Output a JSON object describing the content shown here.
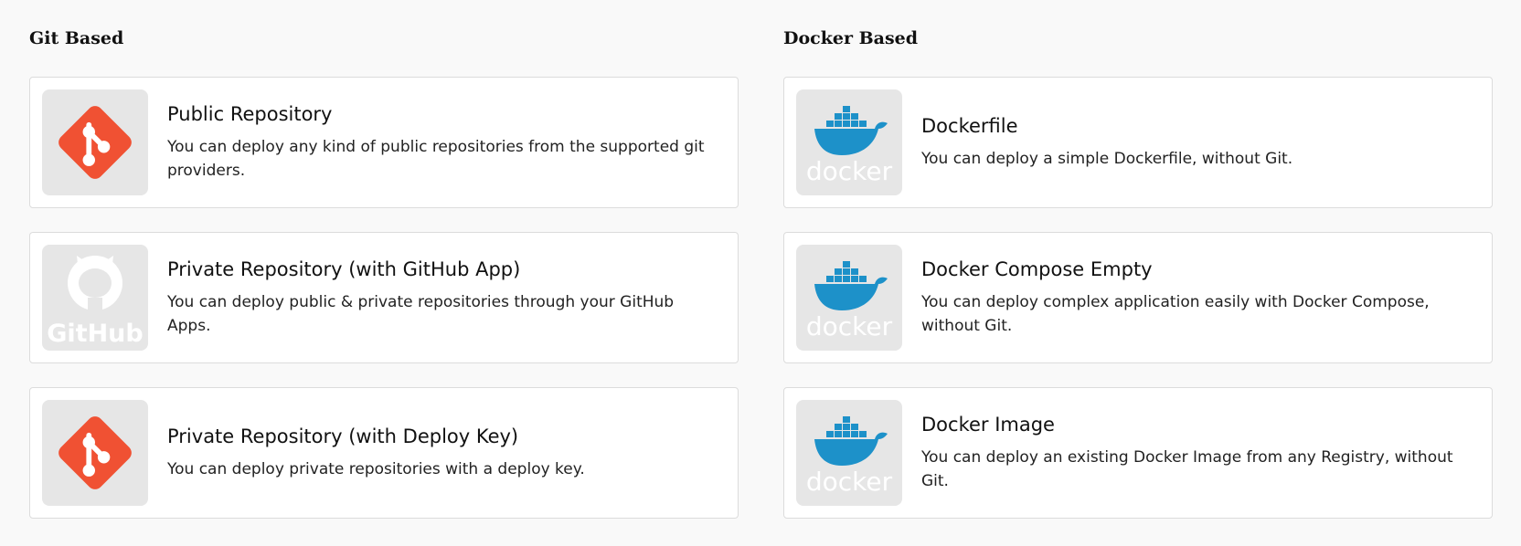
{
  "git_section": {
    "title": "Git Based",
    "cards": [
      {
        "icon": "git-icon",
        "title": "Public Repository",
        "description": "You can deploy any kind of public repositories from the supported git providers."
      },
      {
        "icon": "github-icon",
        "logo_text": "GitHub",
        "title": "Private Repository (with GitHub App)",
        "description": "You can deploy public & private repositories through your GitHub Apps."
      },
      {
        "icon": "git-icon",
        "title": "Private Repository (with Deploy Key)",
        "description": "You can deploy private repositories with a deploy key."
      }
    ]
  },
  "docker_section": {
    "title": "Docker Based",
    "cards": [
      {
        "icon": "docker-icon",
        "logo_text": "docker",
        "title": "Dockerfile",
        "description": "You can deploy a simple Dockerfile, without Git."
      },
      {
        "icon": "docker-icon",
        "logo_text": "docker",
        "title": "Docker Compose Empty",
        "description": "You can deploy complex application easily with Docker Compose, without Git."
      },
      {
        "icon": "docker-icon",
        "logo_text": "docker",
        "title": "Docker Image",
        "description": "You can deploy an existing Docker Image from any Registry, without Git."
      }
    ]
  },
  "colors": {
    "git_orange": "#f05133",
    "docker_blue": "#1d91c9",
    "logo_background": "#e6e6e6",
    "card_border": "#dcdcdc",
    "page_background": "#f9f9f9"
  }
}
